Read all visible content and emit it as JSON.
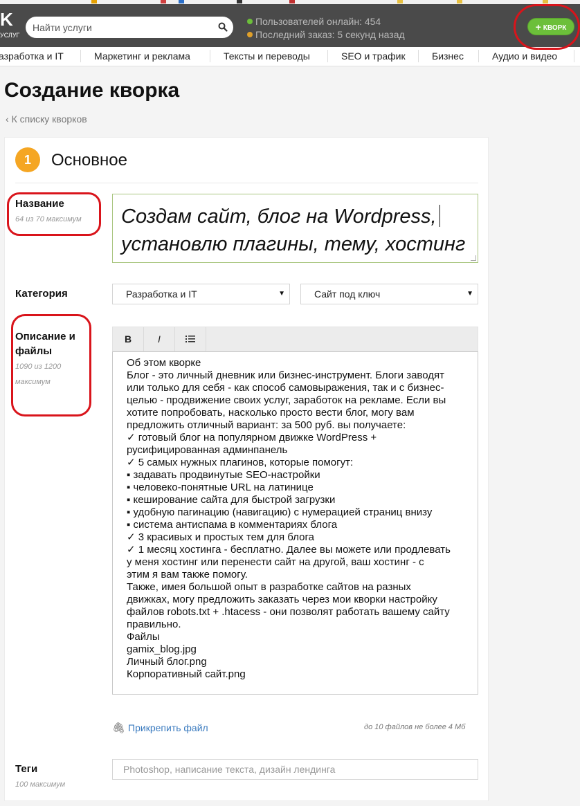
{
  "header": {
    "logo": "K",
    "logo_sub": "УСЛУГ",
    "search_placeholder": "Найти услуги",
    "online_users": "Пользователей онлайн: 454",
    "last_order": "Последний заказ: 5 секунд назад",
    "add_kwork_label": "КВОРК",
    "colors": {
      "header_bg": "#4a4a4a",
      "online_dot": "#6cbf3a",
      "order_dot": "#e0a02a",
      "button": "#6cbf3a"
    }
  },
  "categories": [
    "азработка и IT",
    "Маркетинг и реклама",
    "Тексты и переводы",
    "SEO и трафик",
    "Бизнес",
    "Аудио и видео"
  ],
  "page": {
    "title": "Создание кворка",
    "back_link": "К списку кворков"
  },
  "section": {
    "number": "1",
    "title": "Основное",
    "accent_color": "#f5a623"
  },
  "name_field": {
    "label": "Название",
    "hint": "64 из 70 максимум",
    "value_lines": [
      "Создам сайт, блог на Wordpress,",
      "установлю плагины, тему, хостинг"
    ]
  },
  "category_field": {
    "label": "Категория",
    "selected_category": "Разработка и IT",
    "selected_subcategory": "Сайт под ключ"
  },
  "description_field": {
    "label_lines": [
      "Описание и",
      "файлы"
    ],
    "hint_lines": [
      "1090 из 1200",
      "максимум"
    ],
    "toolbar": {
      "bold": "B",
      "italic": "I",
      "list_icon": "list-icon"
    },
    "lines": [
      "Об этом кворке",
      "Блог - это личный дневник или бизнес-инструмент. Блоги заводят",
      "или только для себя - как способ самовыражения, так и с бизнес-",
      "целью - продвижение своих услуг, заработок на рекламе. Если вы",
      "хотите попробовать, насколько просто вести блог, могу вам",
      "предложить отличный вариант: за 500 руб. вы получаете:",
      "✓ готовый блог на популярном движке WordPress +",
      "русифицированная админпанель",
      "✓ 5 самых нужных плагинов, которые помогут:",
      "▪ задавать продвинутые SEO-настройки",
      "▪ человеко-понятные URL на латинице",
      "▪ кеширование сайта для быстрой загрузки",
      "▪ удобную пагинацию (навигацию) с нумерацией страниц внизу",
      "▪ система антиспама в комментариях блога",
      "✓ 3 красивых и простых тем для блога",
      "✓ 1 месяц хостинга - бесплатно. Далее вы можете или продлевать",
      "у меня хостинг или перенести сайт на другой, ваш хостинг - с",
      "этим я вам также помогу.",
      "Также, имея большой опыт в разработке сайтов на разных",
      "движках, могу предложить заказать через мои кворки настройку",
      "файлов robots.txt + .htacess - они позволят работать вашему сайту",
      "правильно.",
      "Файлы",
      "gamix_blog.jpg",
      "Личный блог.png",
      "Корпоративный сайт.png"
    ]
  },
  "attachments": {
    "link": "Прикрепить файл",
    "note": "до 10 файлов не более 4 Мб"
  },
  "tags_field": {
    "label": "Теги",
    "hint": "100 максимум",
    "placeholder": "Photoshop, написание текста, дизайн лендинга"
  },
  "annotation_color": "#d9141b"
}
